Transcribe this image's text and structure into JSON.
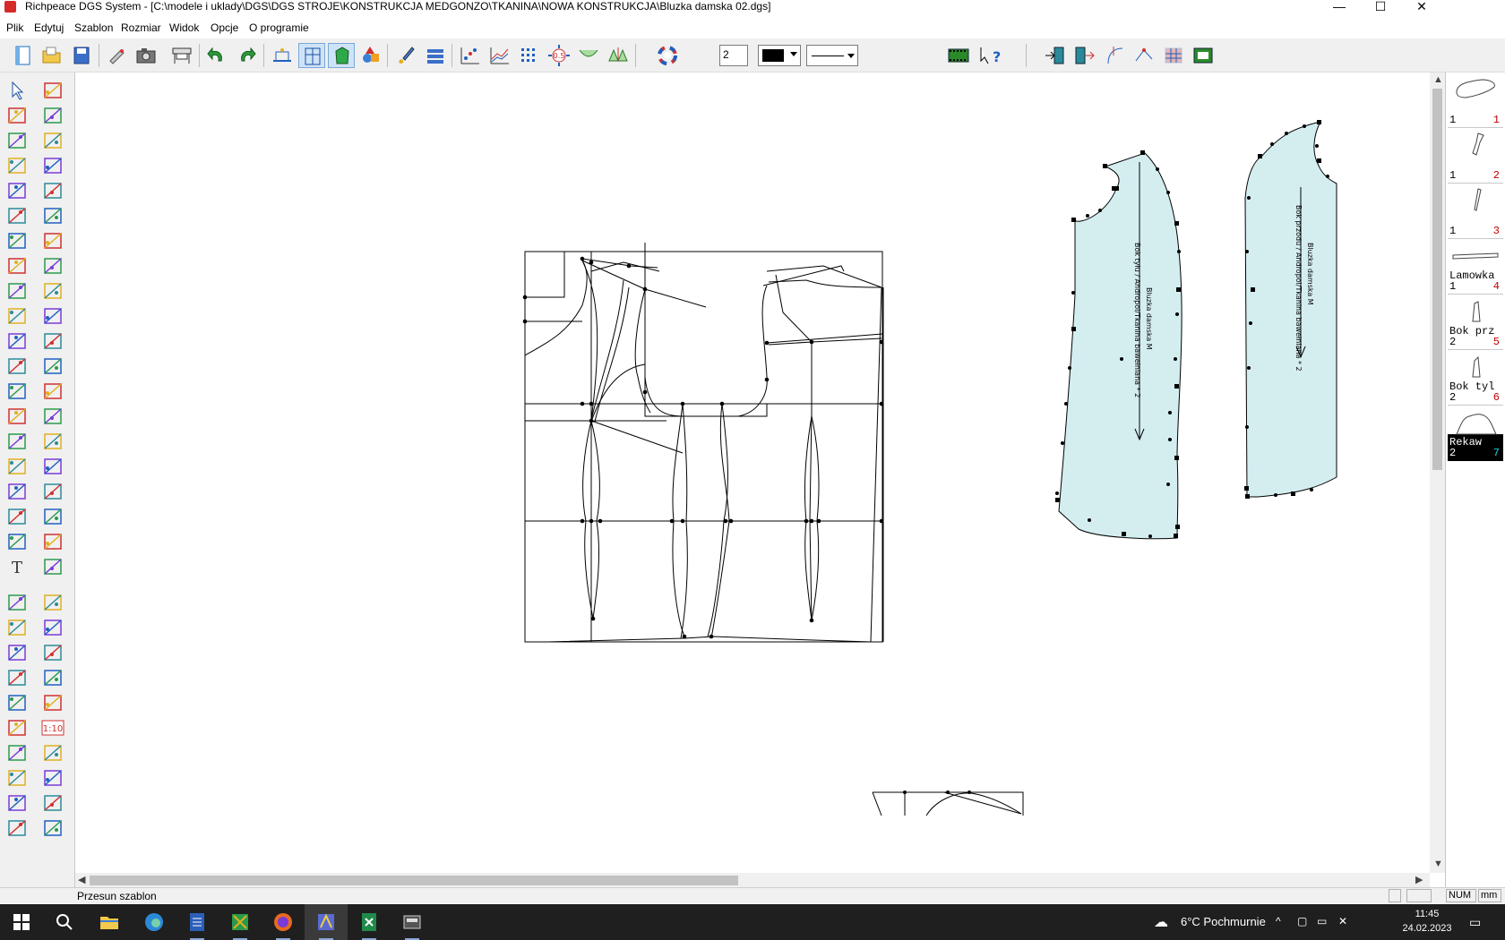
{
  "window": {
    "title": "Richpeace DGS System - [C:\\modele i uklady\\DGS\\DGS STROJE\\KONSTRUKCJA MEDGONZO\\TKANINA\\NOWA KONSTRUKCJA\\Bluzka damska 02.dgs]",
    "minimize": "—",
    "maximize": "☐",
    "close": "✕"
  },
  "menu": [
    "Plik",
    "Edytuj",
    "Szablon",
    "Rozmiar",
    "Widok",
    "Opcje",
    "O programie"
  ],
  "toolbar": {
    "line_width_value": "2",
    "color": "#000000"
  },
  "pieces": [
    {
      "name": "",
      "qty": "1",
      "num": "1"
    },
    {
      "name": "",
      "qty": "1",
      "num": "2"
    },
    {
      "name": "",
      "qty": "1",
      "num": "3"
    },
    {
      "name": "Lamowka",
      "qty": "1",
      "num": "4"
    },
    {
      "name": "Bok prz",
      "qty": "2",
      "num": "5"
    },
    {
      "name": "Bok tyl",
      "qty": "2",
      "num": "6"
    },
    {
      "name": "Rekaw",
      "qty": "2",
      "num": "7"
    }
  ],
  "canvas": {
    "piece_labels": {
      "back_side_1": "Bluzka damska M",
      "back_side_2": "Bok tyłu / Andropol/Tkanina bawełniana * 2",
      "front_side_1": "Bluzka damska M",
      "front_side_2": "Bok przodu / Andropol/Tkanina bawełniana * 2"
    },
    "fill_color": "#d4eef0"
  },
  "status": {
    "message": "Przesun szablon",
    "num": "NUM",
    "unit": "mm"
  },
  "taskbar": {
    "weather": "6°C  Pochmurnie",
    "time": "11:45",
    "date": "24.02.2023"
  }
}
